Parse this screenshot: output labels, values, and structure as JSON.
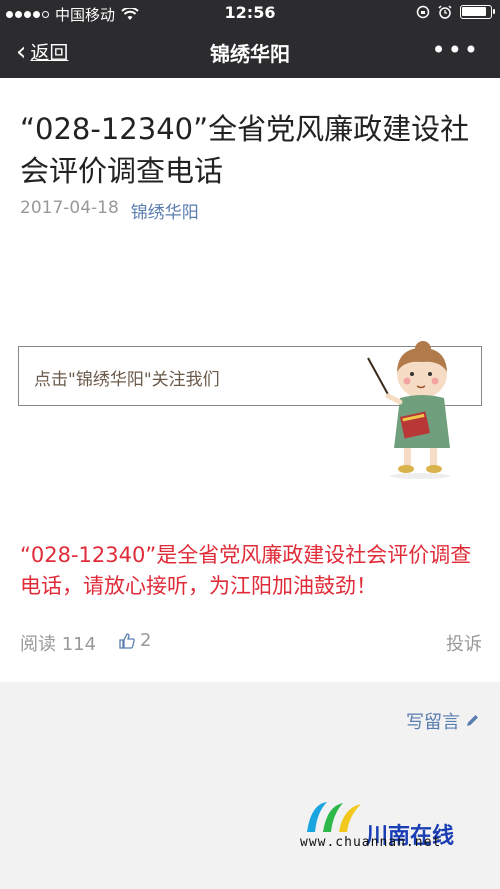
{
  "status_bar": {
    "carrier": "中国移动",
    "time": "12:56"
  },
  "nav": {
    "back_label": "返回",
    "title": "锦绣华阳",
    "more_label": "•••"
  },
  "article": {
    "title": "“028-12340”全省党风廉政建设社会评价调查电话",
    "date": "2017-04-18",
    "account": "锦绣华阳",
    "follow_text": "点击\"锦绣华阳\"关注我们",
    "body_red": "“028-12340”是全省党风廉政建设社会评价调查电话，请放心接听，为江阳加油鼓劲！"
  },
  "footer": {
    "reads_label": "阅读",
    "reads_count": "114",
    "likes_count": "2",
    "report_label": "投诉"
  },
  "comment": {
    "write_label": "写留言"
  },
  "watermark": {
    "name": "川南在线",
    "url": "www.chuannan.net"
  },
  "colors": {
    "nav_bg": "#2c2c2f",
    "link_blue": "#5a7db0",
    "red_text": "#e02c39"
  }
}
